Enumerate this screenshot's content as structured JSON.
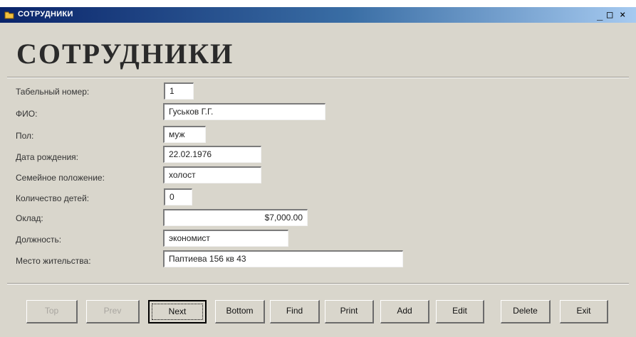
{
  "window": {
    "title": "СОТРУДНИКИ",
    "controls": [
      "_",
      "□",
      "×"
    ]
  },
  "form": {
    "heading": "СОТРУДНИКИ",
    "fields": [
      {
        "label": "Табельный номер:",
        "value": "1"
      },
      {
        "label": "ФИО:",
        "value": "Гуськов Г.Г."
      },
      {
        "label": "Пол:",
        "value": "муж"
      },
      {
        "label": "Дата рождения:",
        "value": "22.02.1976"
      },
      {
        "label": "Семейное положение:",
        "value": "холост"
      },
      {
        "label": "Количество детей:",
        "value": "0"
      },
      {
        "label": "Оклад:",
        "value": "$7,000.00"
      },
      {
        "label": "Должность:",
        "value": "экономист"
      },
      {
        "label": "Место жительства:",
        "value": "Паптиева 156 кв 43"
      }
    ]
  },
  "buttons": [
    {
      "label": "Top",
      "enabled": false
    },
    {
      "label": "Prev",
      "enabled": false
    },
    {
      "label": "Next",
      "enabled": true
    },
    {
      "label": "Bottom",
      "enabled": true
    },
    {
      "label": "Find",
      "enabled": true
    },
    {
      "label": "Print",
      "enabled": true
    },
    {
      "label": "Add",
      "enabled": true
    },
    {
      "label": "Edit",
      "enabled": true
    },
    {
      "label": "Delete",
      "enabled": true
    },
    {
      "label": "Exit",
      "enabled": true
    }
  ]
}
